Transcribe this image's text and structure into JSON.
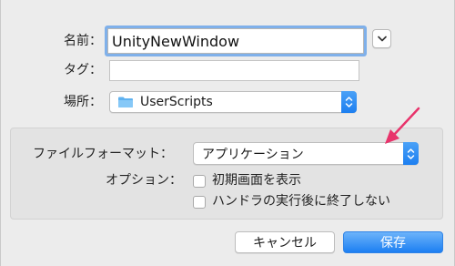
{
  "dialog": {
    "name_label": "名前：",
    "name_value": "UnityNewWindow",
    "tags_label": "タグ：",
    "tags_value": "",
    "where_label": "場所：",
    "where_value": "UserScripts",
    "expand_icon": "chevron-down-icon",
    "folder_icon": "folder-icon",
    "focus_color": "#7fb0ea"
  },
  "options": {
    "file_format_label": "ファイルフォーマット：",
    "file_format_value": "アプリケーション",
    "options_label": "オプション：",
    "checkboxes": [
      {
        "label": "初期画面を表示",
        "checked": false
      },
      {
        "label": "ハンドラの実行後に終了しない",
        "checked": false
      }
    ]
  },
  "buttons": {
    "cancel_label": "キャンセル",
    "save_label": "保存",
    "accent_color": "#1c7ff2"
  },
  "annotation": {
    "arrow_color": "#e8336b"
  }
}
